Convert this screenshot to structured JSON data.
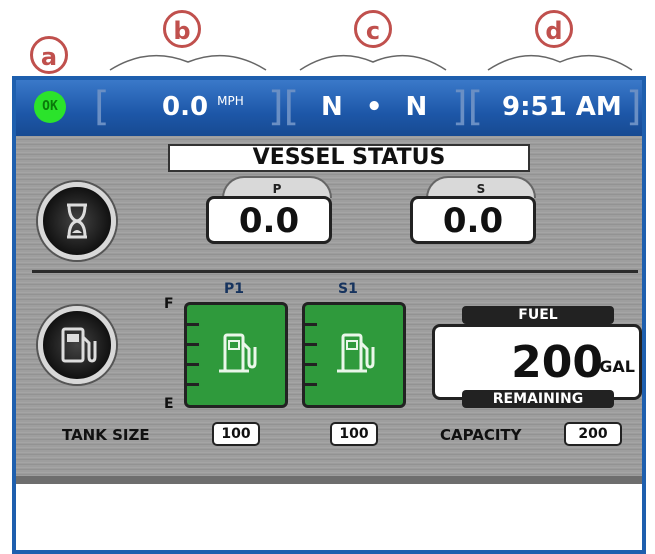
{
  "annotations": {
    "a": "a",
    "b": "b",
    "c": "c",
    "d": "d"
  },
  "status_bar": {
    "ok_label": "OK",
    "speed_value": "0.0",
    "speed_unit": "MPH",
    "heading_left": "N",
    "heading_sep": "•",
    "heading_right": "N",
    "time": "9:51 AM"
  },
  "page_title": "VESSEL STATUS",
  "engine_hours": {
    "port_label": "P",
    "port_value": "0.0",
    "starboard_label": "S",
    "starboard_value": "0.0"
  },
  "fuel": {
    "full_marker": "F",
    "empty_marker": "E",
    "tanks": [
      {
        "label": "P1",
        "size": "100"
      },
      {
        "label": "S1",
        "size": "100"
      }
    ],
    "tank_size_label": "TANK SIZE",
    "panel_label": "FUEL",
    "remaining_value": "200",
    "remaining_unit": "GAL",
    "remaining_label": "REMAINING",
    "capacity_label": "CAPACITY",
    "capacity_value": "200"
  },
  "colors": {
    "topbar_blue": "#1d57a8",
    "ok_green": "#2be32b",
    "tank_green": "#2f9a3c",
    "annotation_red": "#c0504d"
  }
}
